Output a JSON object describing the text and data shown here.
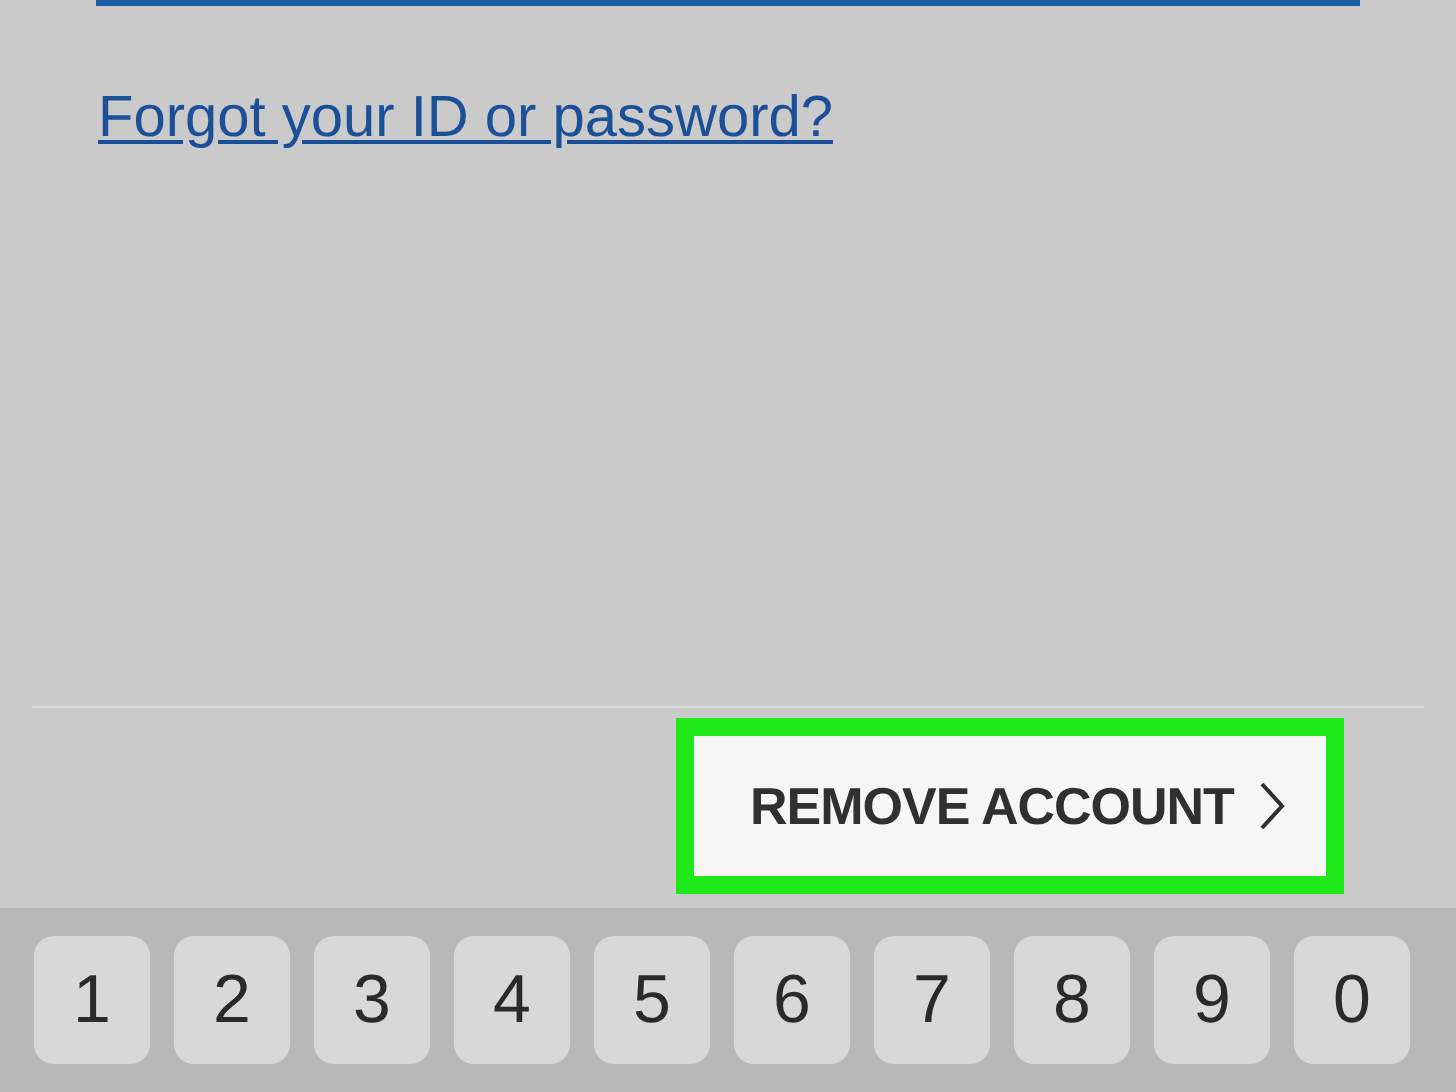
{
  "link": {
    "label": "Forgot your ID or password?"
  },
  "remove_button": {
    "label": "REMOVE ACCOUNT",
    "highlighted": true
  },
  "keyboard": {
    "keys": [
      "1",
      "2",
      "3",
      "4",
      "5",
      "6",
      "7",
      "8",
      "9",
      "0"
    ]
  }
}
